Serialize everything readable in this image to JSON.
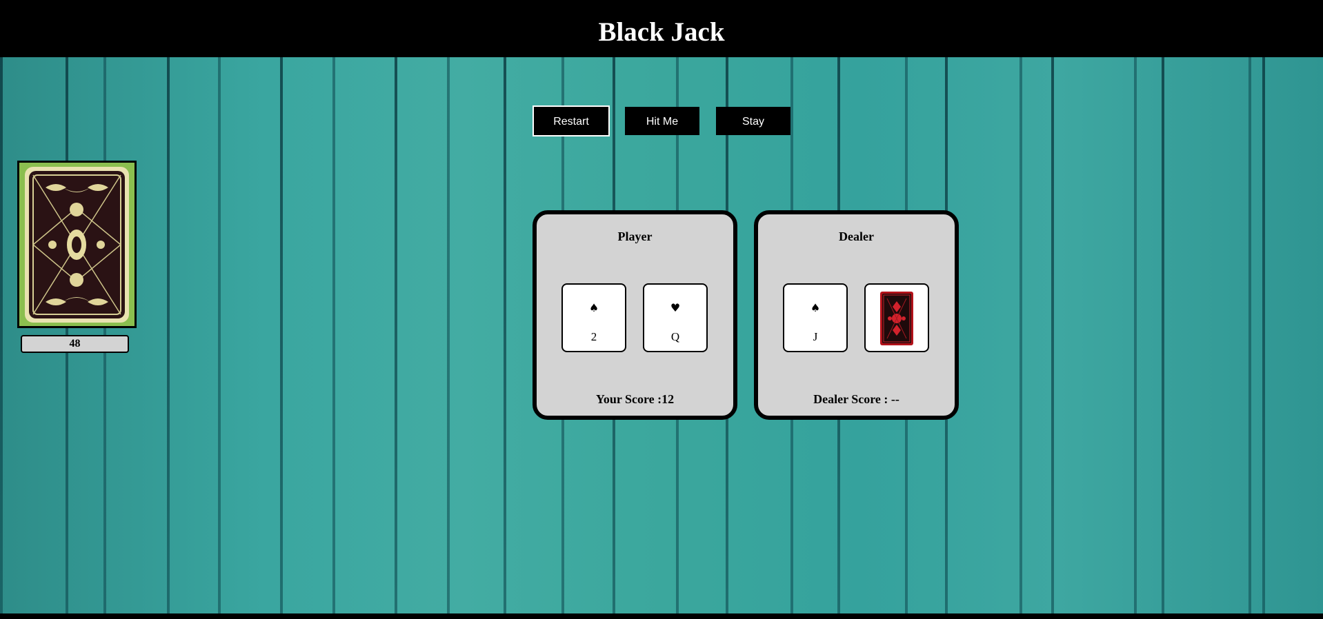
{
  "header": {
    "title": "Black Jack"
  },
  "deck": {
    "count": "48",
    "icon": "card-back-icon"
  },
  "controls": {
    "restart_label": "Restart",
    "hit_label": "Hit Me",
    "stay_label": "Stay"
  },
  "player": {
    "title": "Player",
    "cards": [
      {
        "suit": "♠",
        "rank": "2"
      },
      {
        "suit": "♥",
        "rank": "Q"
      }
    ],
    "score_text": "Your Score :12"
  },
  "dealer": {
    "title": "Dealer",
    "cards": [
      {
        "suit": "♠",
        "rank": "J"
      },
      {
        "face_down": true
      }
    ],
    "score_text": "Dealer Score : --"
  },
  "colors": {
    "table": "#3ba79d",
    "panel": "#d3d3d3",
    "header": "#000000",
    "deck_back": "#8bbf4f",
    "hidden_card_back": "#b3121a"
  }
}
